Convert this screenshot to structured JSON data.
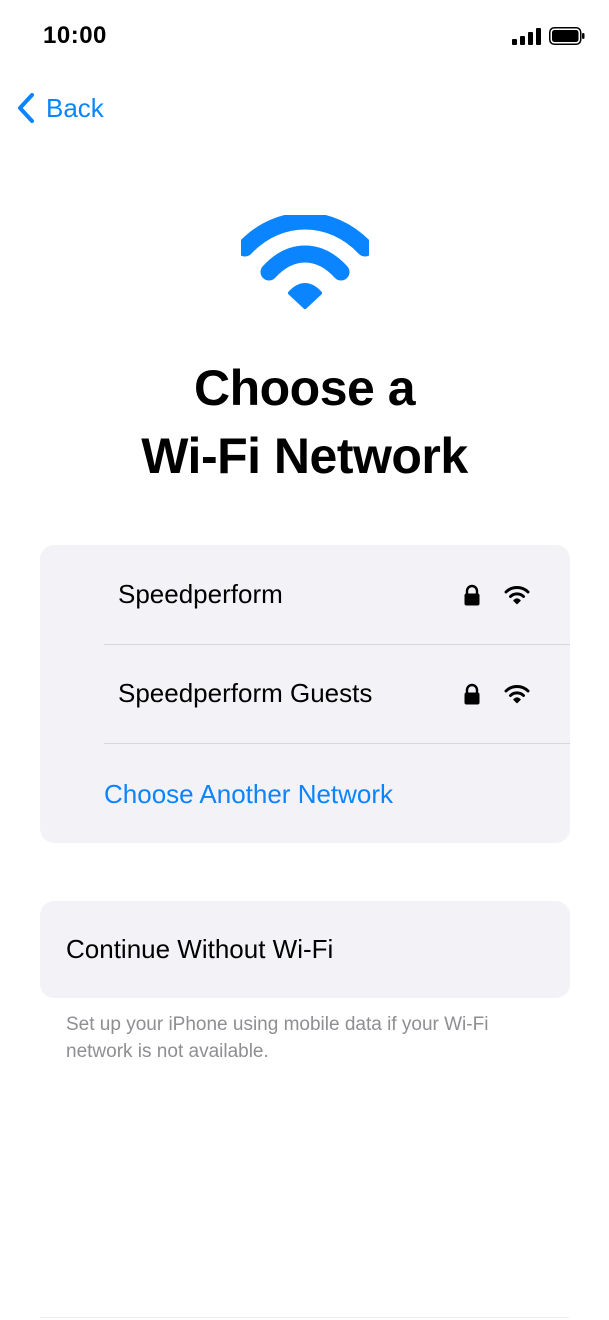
{
  "status_bar": {
    "time": "10:00"
  },
  "nav": {
    "back_label": "Back"
  },
  "title": {
    "line1": "Choose a",
    "line2": "Wi-Fi Network"
  },
  "networks": [
    {
      "name": "Speedperform",
      "secured": true,
      "icon": "wifi-icon"
    },
    {
      "name": "Speedperform Guests",
      "secured": true,
      "icon": "wifi-icon"
    }
  ],
  "choose_another_label": "Choose Another Network",
  "continue_without_wifi_label": "Continue Without Wi-Fi",
  "footnote": "Set up your iPhone using mobile data if your Wi-Fi network is not available.",
  "colors": {
    "accent": "#0a84ff",
    "card_background": "#f3f3f7",
    "secondary_text": "#8e8e93"
  }
}
